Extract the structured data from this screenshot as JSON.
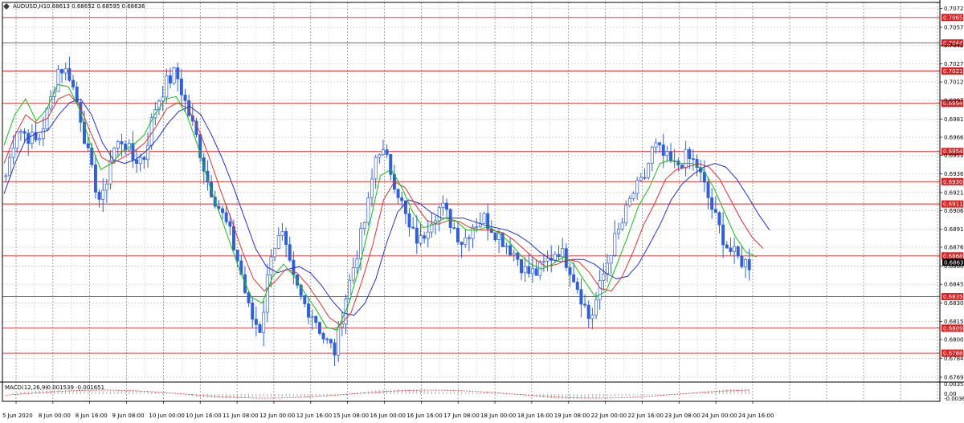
{
  "window": {
    "symbol_caption": "AUDUSD,H1",
    "ohlc": "0.68613 0.68652 0.68595 0.68636",
    "current_price": "0.68636"
  },
  "indicator": {
    "caption": "MACD(12,26,9)",
    "values": "-0.001539 -0.001651",
    "axis_labels": [
      "0.003537",
      "0.00",
      "-0.003651"
    ]
  },
  "colors": {
    "candles": "#3060d8",
    "level_line": "#e02020",
    "level_tag": "#e02020",
    "ma_fast": "#10c010",
    "ma_mid": "#e03030",
    "ma_slow": "#2030d0",
    "grid": "#c8c8c8",
    "current_tag": "#000000",
    "macd_hist": "#b0b0b0",
    "macd_signal": "#e03030"
  },
  "chart_data": {
    "type": "candlestick",
    "price_axis_ticks": [
      "0.70725",
      "0.70570",
      "0.70420",
      "0.70270",
      "0.70120",
      "0.69970",
      "0.69815",
      "0.69665",
      "0.69515",
      "0.69365",
      "0.69210",
      "0.69060",
      "0.68910",
      "0.68760",
      "0.68605",
      "0.68455",
      "0.68300",
      "0.68150",
      "0.68000",
      "0.67845",
      "0.67690"
    ],
    "price_levels": [
      "0.70651",
      "0.70441",
      "0.70211",
      "0.69945",
      "0.69548",
      "0.69300",
      "0.69116",
      "0.68689",
      "0.68354",
      "0.68094",
      "0.67888"
    ],
    "time_labels": [
      "5 Jun 2020",
      "8 Jun 00:00",
      "8 Jun 16:00",
      "9 Jun 08:00",
      "10 Jun 00:00",
      "10 Jun 16:00",
      "11 Jun 08:00",
      "12 Jun 00:00",
      "12 Jun 16:00",
      "15 Jun 08:00",
      "16 Jun 00:00",
      "16 Jun 16:00",
      "17 Jun 08:00",
      "18 Jun 00:00",
      "18 Jun 16:00",
      "19 Jun 08:00",
      "22 Jun 00:00",
      "22 Jun 16:00",
      "23 Jun 08:00",
      "24 Jun 00:00",
      "24 Jun 16:00"
    ],
    "y_range": [
      0.6769,
      0.70775
    ],
    "close_path": [
      0.6935,
      0.6975,
      0.6968,
      0.6962,
      0.699,
      0.7025,
      0.7018,
      0.6985,
      0.694,
      0.691,
      0.6955,
      0.6965,
      0.6948,
      0.695,
      0.699,
      0.701,
      0.702,
      0.6992,
      0.6965,
      0.693,
      0.691,
      0.689,
      0.686,
      0.682,
      0.6808,
      0.6875,
      0.6885,
      0.685,
      0.683,
      0.682,
      0.68,
      0.679,
      0.6835,
      0.687,
      0.6905,
      0.696,
      0.6945,
      0.692,
      0.689,
      0.688,
      0.69,
      0.691,
      0.6895,
      0.688,
      0.6895,
      0.69,
      0.689,
      0.688,
      0.687,
      0.6855,
      0.6855,
      0.6865,
      0.6875,
      0.6862,
      0.684,
      0.6815,
      0.6845,
      0.6875,
      0.6895,
      0.692,
      0.693,
      0.696,
      0.695,
      0.6942,
      0.695,
      0.6945,
      0.692,
      0.6895,
      0.6875,
      0.6866,
      0.6862
    ],
    "ma_fast": [
      0.696,
      0.6985,
      0.6998,
      0.698,
      0.699,
      0.701,
      0.7008,
      0.699,
      0.6962,
      0.694,
      0.6945,
      0.6955,
      0.696,
      0.6968,
      0.6985,
      0.6998,
      0.7,
      0.6985,
      0.696,
      0.693,
      0.6905,
      0.688,
      0.6855,
      0.6835,
      0.683,
      0.6852,
      0.6862,
      0.6852,
      0.6838,
      0.6825,
      0.681,
      0.6808,
      0.6828,
      0.6858,
      0.6895,
      0.6935,
      0.694,
      0.6925,
      0.6905,
      0.6892,
      0.6895,
      0.69,
      0.6898,
      0.689,
      0.689,
      0.6893,
      0.6888,
      0.688,
      0.687,
      0.6862,
      0.6858,
      0.6862,
      0.6868,
      0.6862,
      0.6848,
      0.6835,
      0.684,
      0.6862,
      0.6885,
      0.691,
      0.6925,
      0.6945,
      0.6948,
      0.6945,
      0.6945,
      0.694,
      0.6925,
      0.6905,
      0.6885,
      0.6872,
      0.6868
    ],
    "ma_mid": [
      0.6945,
      0.6968,
      0.6985,
      0.6978,
      0.6982,
      0.6998,
      0.7002,
      0.6992,
      0.697,
      0.695,
      0.6945,
      0.695,
      0.6955,
      0.6962,
      0.6975,
      0.699,
      0.6995,
      0.699,
      0.6972,
      0.6948,
      0.6922,
      0.6898,
      0.6872,
      0.685,
      0.684,
      0.6848,
      0.6858,
      0.6855,
      0.6845,
      0.6832,
      0.6818,
      0.6812,
      0.6822,
      0.6848,
      0.6878,
      0.6915,
      0.693,
      0.6925,
      0.691,
      0.6898,
      0.6895,
      0.6898,
      0.6897,
      0.6892,
      0.689,
      0.689,
      0.6888,
      0.6882,
      0.6874,
      0.6866,
      0.686,
      0.6862,
      0.6866,
      0.6864,
      0.6855,
      0.6842,
      0.684,
      0.6852,
      0.6872,
      0.6895,
      0.6912,
      0.6932,
      0.694,
      0.6942,
      0.6945,
      0.6942,
      0.6932,
      0.6915,
      0.6898,
      0.6884,
      0.6875
    ],
    "ma_slow": [
      0.692,
      0.6945,
      0.6965,
      0.697,
      0.6972,
      0.6985,
      0.6995,
      0.6998,
      0.6985,
      0.6962,
      0.6948,
      0.6945,
      0.6948,
      0.6955,
      0.6965,
      0.6978,
      0.6988,
      0.6992,
      0.6985,
      0.6968,
      0.6948,
      0.6925,
      0.69,
      0.6875,
      0.686,
      0.6855,
      0.6858,
      0.686,
      0.6855,
      0.6845,
      0.6832,
      0.6822,
      0.682,
      0.683,
      0.685,
      0.688,
      0.6905,
      0.6915,
      0.6912,
      0.6905,
      0.69,
      0.69,
      0.69,
      0.6897,
      0.6894,
      0.6892,
      0.689,
      0.6886,
      0.688,
      0.6872,
      0.6866,
      0.6864,
      0.6866,
      0.6866,
      0.6862,
      0.6855,
      0.685,
      0.6852,
      0.6862,
      0.6878,
      0.6895,
      0.6915,
      0.6928,
      0.6936,
      0.6942,
      0.6945,
      0.6942,
      0.6932,
      0.6918,
      0.6903,
      0.689
    ]
  }
}
